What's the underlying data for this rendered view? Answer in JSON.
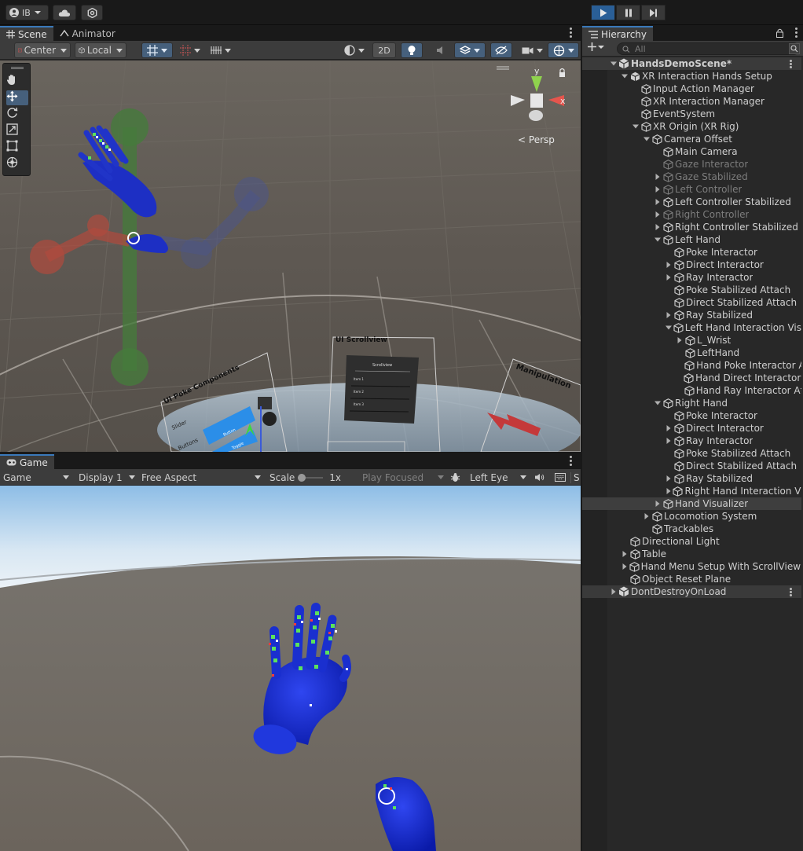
{
  "toolbar": {
    "account_label": "IB",
    "account_icon": "account-icon",
    "cloud_icon": "cloud-icon",
    "settings_icon": "settings-icon",
    "play_icon": "play-icon",
    "pause_icon": "pause-icon",
    "step_icon": "step-icon"
  },
  "scene": {
    "tabs": [
      {
        "label": "Scene",
        "icon": "grid-icon",
        "active": true
      },
      {
        "label": "Animator",
        "icon": "animator-icon",
        "active": false
      }
    ],
    "pivot_label": "Center",
    "space_label": "Local",
    "mode_2d_label": "2D",
    "persp_label": "Persp",
    "gizmo_axis_y": "y",
    "gizmo_axis_x": "x",
    "canvas_labels": {
      "poke_components": "UI Poke Components",
      "slider": "Slider",
      "buttons": "Buttons",
      "button": "Button",
      "toggle": "Toggle",
      "scrollview_title": "UI Scrollview",
      "scrollview_header": "Scrollview",
      "item1": "Item 1",
      "item2": "Item 2",
      "item3": "Item 3",
      "manipulation": "Manipulation"
    }
  },
  "game": {
    "tab_label": "Game",
    "mode_dropdown": "Game",
    "display_dropdown": "Display 1",
    "aspect_dropdown": "Free Aspect",
    "scale_label": "Scale",
    "scale_value": "1x",
    "play_focused_dropdown": "Play Focused",
    "eye_dropdown": "Left Eye",
    "stats_label": "S"
  },
  "hierarchy": {
    "tab_label": "Hierarchy",
    "search_placeholder": "All",
    "items": [
      {
        "label": "HandsDemoScene*",
        "indent": 0,
        "fold": "open",
        "type": "scene"
      },
      {
        "label": "XR Interaction Hands Setup",
        "indent": 1,
        "fold": "open",
        "type": "prefab"
      },
      {
        "label": "Input Action Manager",
        "indent": 2,
        "fold": "none",
        "type": "object"
      },
      {
        "label": "XR Interaction Manager",
        "indent": 2,
        "fold": "none",
        "type": "object"
      },
      {
        "label": "EventSystem",
        "indent": 2,
        "fold": "none",
        "type": "object"
      },
      {
        "label": "XR Origin (XR Rig)",
        "indent": 2,
        "fold": "open",
        "type": "object"
      },
      {
        "label": "Camera Offset",
        "indent": 3,
        "fold": "open",
        "type": "object"
      },
      {
        "label": "Main Camera",
        "indent": 4,
        "fold": "none",
        "type": "object"
      },
      {
        "label": "Gaze Interactor",
        "indent": 4,
        "fold": "none",
        "type": "object",
        "dim": true
      },
      {
        "label": "Gaze Stabilized",
        "indent": 4,
        "fold": "closed",
        "type": "object",
        "dim": true
      },
      {
        "label": "Left Controller",
        "indent": 4,
        "fold": "closed",
        "type": "object",
        "dim": true
      },
      {
        "label": "Left Controller Stabilized",
        "indent": 4,
        "fold": "closed",
        "type": "object"
      },
      {
        "label": "Right Controller",
        "indent": 4,
        "fold": "closed",
        "type": "object",
        "dim": true
      },
      {
        "label": "Right Controller Stabilized",
        "indent": 4,
        "fold": "closed",
        "type": "object"
      },
      {
        "label": "Left Hand",
        "indent": 4,
        "fold": "open",
        "type": "object"
      },
      {
        "label": "Poke Interactor",
        "indent": 5,
        "fold": "none",
        "type": "object"
      },
      {
        "label": "Direct Interactor",
        "indent": 5,
        "fold": "closed",
        "type": "object"
      },
      {
        "label": "Ray Interactor",
        "indent": 5,
        "fold": "closed",
        "type": "object"
      },
      {
        "label": "Poke Stabilized Attach",
        "indent": 5,
        "fold": "none",
        "type": "object"
      },
      {
        "label": "Direct Stabilized Attach",
        "indent": 5,
        "fold": "none",
        "type": "object"
      },
      {
        "label": "Ray Stabilized",
        "indent": 5,
        "fold": "closed",
        "type": "object"
      },
      {
        "label": "Left Hand Interaction Visu",
        "indent": 5,
        "fold": "open",
        "type": "object"
      },
      {
        "label": "L_Wrist",
        "indent": 6,
        "fold": "closed",
        "type": "object"
      },
      {
        "label": "LeftHand",
        "indent": 6,
        "fold": "none",
        "type": "object"
      },
      {
        "label": "Hand Poke Interactor A",
        "indent": 6,
        "fold": "none",
        "type": "object"
      },
      {
        "label": "Hand Direct Interactor A",
        "indent": 6,
        "fold": "none",
        "type": "object"
      },
      {
        "label": "Hand Ray Interactor Aff",
        "indent": 6,
        "fold": "none",
        "type": "object"
      },
      {
        "label": "Right Hand",
        "indent": 4,
        "fold": "open",
        "type": "object"
      },
      {
        "label": "Poke Interactor",
        "indent": 5,
        "fold": "none",
        "type": "object"
      },
      {
        "label": "Direct Interactor",
        "indent": 5,
        "fold": "closed",
        "type": "object"
      },
      {
        "label": "Ray Interactor",
        "indent": 5,
        "fold": "closed",
        "type": "object"
      },
      {
        "label": "Poke Stabilized Attach",
        "indent": 5,
        "fold": "none",
        "type": "object"
      },
      {
        "label": "Direct Stabilized Attach",
        "indent": 5,
        "fold": "none",
        "type": "object"
      },
      {
        "label": "Ray Stabilized",
        "indent": 5,
        "fold": "closed",
        "type": "object"
      },
      {
        "label": "Right Hand Interaction Vis",
        "indent": 5,
        "fold": "closed",
        "type": "object"
      },
      {
        "label": "Hand Visualizer",
        "indent": 4,
        "fold": "closed",
        "type": "object",
        "selected": true
      },
      {
        "label": "Locomotion System",
        "indent": 3,
        "fold": "closed",
        "type": "object"
      },
      {
        "label": "Trackables",
        "indent": 3,
        "fold": "none",
        "type": "object"
      },
      {
        "label": "Directional Light",
        "indent": 1,
        "fold": "none",
        "type": "object"
      },
      {
        "label": "Table",
        "indent": 1,
        "fold": "closed",
        "type": "object"
      },
      {
        "label": "Hand Menu Setup With ScrollView V",
        "indent": 1,
        "fold": "closed",
        "type": "object"
      },
      {
        "label": "Object Reset Plane",
        "indent": 1,
        "fold": "none",
        "type": "object"
      },
      {
        "label": "DontDestroyOnLoad",
        "indent": 0,
        "fold": "closed",
        "type": "scene"
      }
    ]
  },
  "colors": {
    "accent": "#3a79bb",
    "play_active": "#2a5f97",
    "panel_bg": "#282828",
    "toolbar_bg": "#3c3c3c",
    "hand_blue": "#1d2fc4"
  }
}
